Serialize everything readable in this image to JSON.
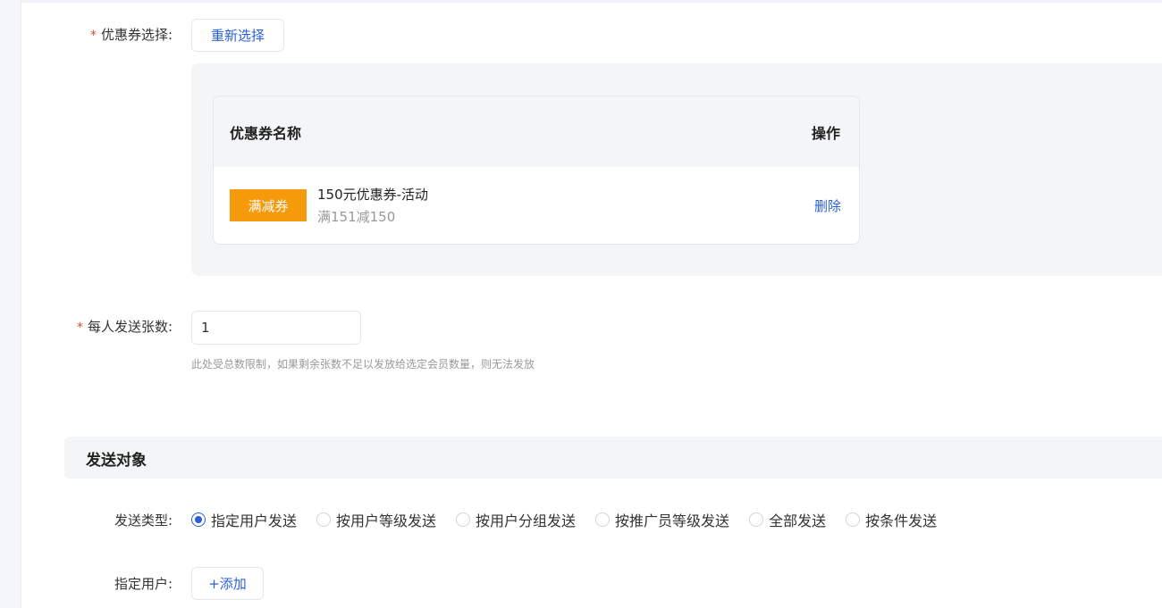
{
  "coupon_select": {
    "label": "优惠券选择:",
    "required_mark": "*",
    "reselect_button": "重新选择",
    "table": {
      "col_name": "优惠券名称",
      "col_action": "操作",
      "rows": [
        {
          "tag": "满减券",
          "name": "150元优惠券-活动",
          "detail": "满151减150",
          "action": "删除"
        }
      ]
    }
  },
  "per_person": {
    "label": "每人发送张数:",
    "required_mark": "*",
    "value": "1",
    "hint": "此处受总数限制，如果剩余张数不足以发放给选定会员数量，则无法发放"
  },
  "section": {
    "title": "发送对象"
  },
  "send_type": {
    "label": "发送类型:",
    "options": [
      {
        "label": "指定用户发送",
        "selected": true
      },
      {
        "label": "按用户等级发送",
        "selected": false
      },
      {
        "label": "按用户分组发送",
        "selected": false
      },
      {
        "label": "按推广员等级发送",
        "selected": false
      },
      {
        "label": "全部发送",
        "selected": false
      },
      {
        "label": "按条件发送",
        "selected": false
      }
    ]
  },
  "specify_user": {
    "label": "指定用户:",
    "add_button": "+添加"
  },
  "colors": {
    "accent": "#2a5fd9",
    "tag": "#f59a0a",
    "required": "#e0492d"
  }
}
